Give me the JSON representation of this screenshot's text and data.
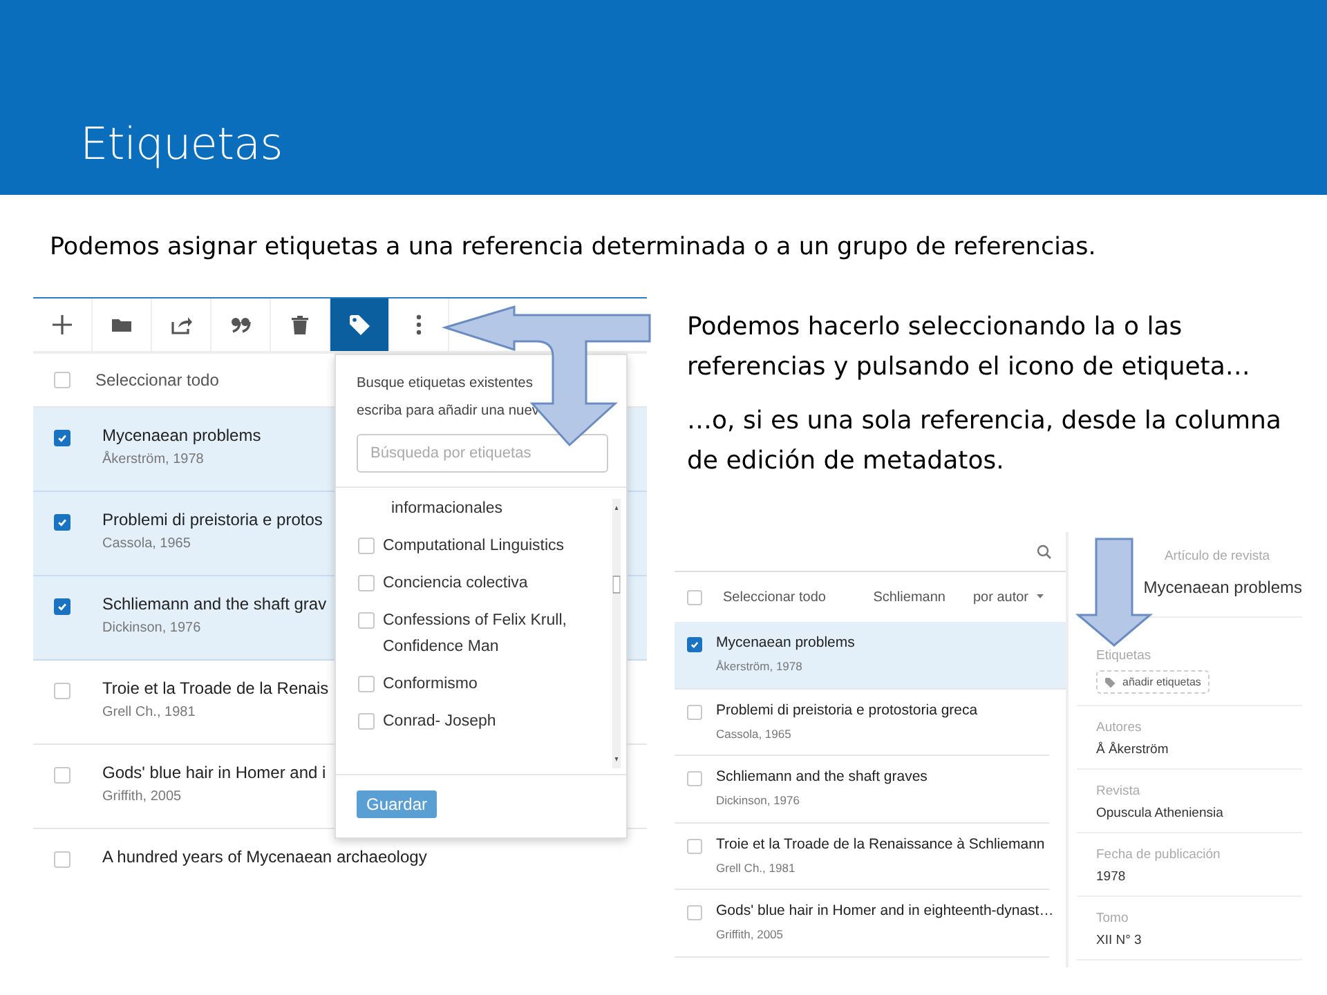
{
  "slide": {
    "title": "Etiquetas",
    "intro": "Podemos asignar etiquetas a una referencia determinada o a un grupo de referencias.",
    "notes": [
      "Podemos hacerlo seleccionando la o las referencias y pulsando el icono de etiqueta…",
      "…o, si es una sola referencia, desde la columna de edición de metadatos."
    ]
  },
  "list_app": {
    "toolbar": [
      {
        "kind": "add",
        "selected": false
      },
      {
        "kind": "folder",
        "selected": false
      },
      {
        "kind": "export",
        "selected": false
      },
      {
        "kind": "quote",
        "selected": false
      },
      {
        "kind": "trash",
        "selected": false
      },
      {
        "kind": "tag",
        "selected": true
      },
      {
        "kind": "more",
        "selected": false
      }
    ],
    "select_all": {
      "label": "Seleccionar todo",
      "checked": false
    },
    "references": [
      {
        "title": "Mycenaean problems",
        "author": "Åkerström, 1978",
        "checked": true
      },
      {
        "title": "Problemi di preistoria e protos",
        "author": "Cassola, 1965",
        "checked": true
      },
      {
        "title": "Schliemann and the shaft grav",
        "author": "Dickinson, 1976",
        "checked": true
      },
      {
        "title": "Troie et la Troade de la Renais",
        "author": "Grell Ch., 1981",
        "checked": false
      },
      {
        "title": "Gods' blue hair in Homer and i",
        "author": "Griffith, 2005",
        "checked": false
      },
      {
        "title": "A hundred years of Mycenaean archaeology",
        "checked": false
      }
    ],
    "tag_popup": {
      "hint": [
        "Busque etiquetas existentes",
        "escriba para añadir una nuev"
      ],
      "search": {
        "placeholder": "Búsqueda por etiquetas"
      },
      "tags": [
        {
          "kind": "continuation",
          "label": "informacionales"
        },
        {
          "kind": "tag",
          "label": "Computational Linguistics",
          "checked": false
        },
        {
          "kind": "tag",
          "label": "Conciencia colectiva",
          "checked": false
        },
        {
          "kind": "tag",
          "label": "Confessions of Felix Krull, Confidence Man",
          "checked": false
        },
        {
          "kind": "tag",
          "label": "Conformismo",
          "checked": false
        },
        {
          "kind": "tag",
          "label": "Conrad- Joseph",
          "checked": false
        }
      ],
      "save_button": "Guardar"
    }
  },
  "detail_app": {
    "select_all": {
      "label": "Seleccionar todo",
      "checked": false
    },
    "filter": "Schliemann",
    "sort": "por autor",
    "references": [
      {
        "title": "Mycenaean problems",
        "author": "Åkerström, 1978",
        "checked": true
      },
      {
        "title": "Problemi di preistoria e protostoria greca",
        "author": "Cassola, 1965",
        "checked": false
      },
      {
        "title": "Schliemann and the shaft graves",
        "author": "Dickinson, 1976",
        "checked": false
      },
      {
        "title": "Troie et la Troade de la Renaissance à Schliemann",
        "author": "Grell Ch., 1981",
        "checked": false
      },
      {
        "title": "Gods' blue hair in Homer and in eighteenth-dynast…",
        "author": "Griffith, 2005",
        "checked": false
      }
    ],
    "detail": {
      "type": "Artículo de revista",
      "title": "Mycenaean problems",
      "tags_label": "Etiquetas",
      "add_tags": "añadir etiquetas",
      "fields": [
        {
          "label": "Autores",
          "value": "Å Åkerström"
        },
        {
          "label": "Revista",
          "value": "Opuscula Atheniensia"
        },
        {
          "label": "Fecha de publicación",
          "value": "1978"
        },
        {
          "label": "Tomo",
          "value": "XII N° 3"
        }
      ]
    }
  }
}
